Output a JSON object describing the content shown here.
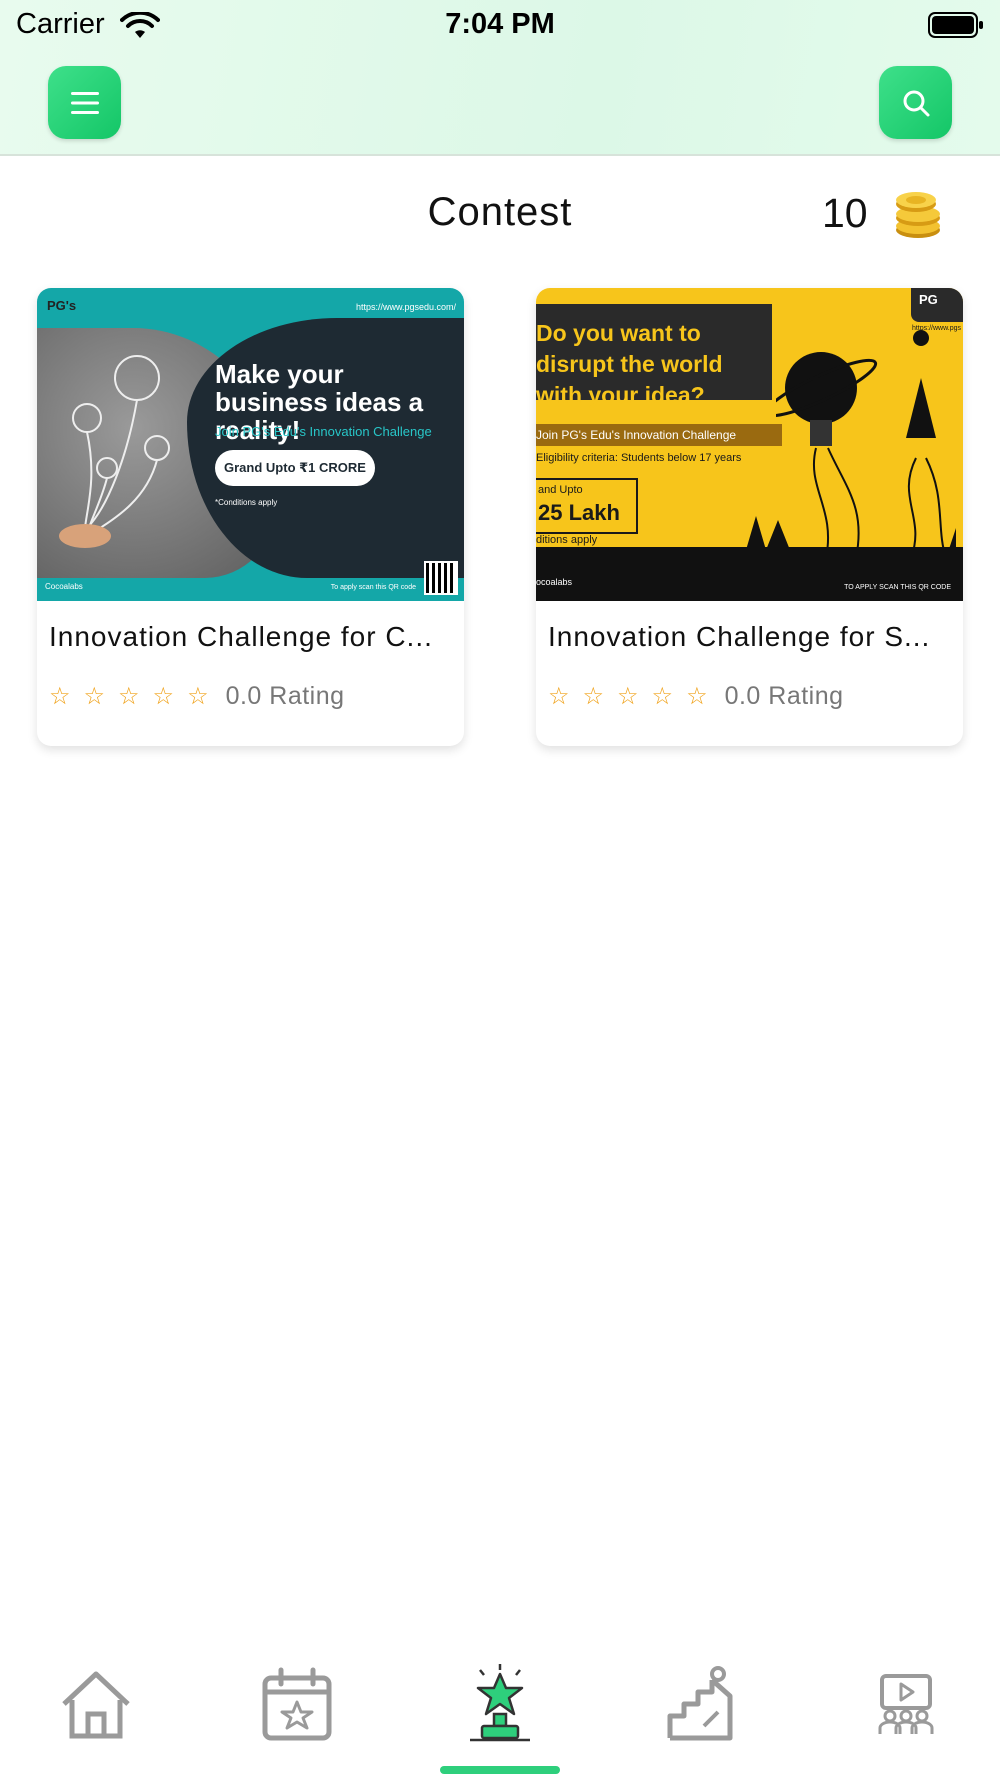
{
  "status_bar": {
    "carrier": "Carrier",
    "time": "7:04 PM"
  },
  "header": {
    "menu_icon": "hamburger-icon",
    "search_icon": "search-icon"
  },
  "page": {
    "title": "Contest",
    "coins": "10",
    "coin_icon": "coins-icon"
  },
  "contests": [
    {
      "title": "Innovation Challenge for C...",
      "rating_text": "0.0 Rating",
      "stars": 0,
      "banner": {
        "logo": "PG's",
        "url": "https://www.pgsedu.com/",
        "headline": "Make your business ideas a reality!",
        "subline": "Join PG's Edu's Innovation Challenge",
        "prize": "Grand Upto ₹1 CRORE",
        "conditions": "*Conditions apply",
        "footer_left": "Cocoalabs",
        "footer_right": "To apply scan this QR code"
      }
    },
    {
      "title": "Innovation Challenge for S...",
      "rating_text": "0.0 Rating",
      "stars": 0,
      "banner": {
        "logo": "PG",
        "url": "https://www.pgs",
        "headline": "Do you want to disrupt the world with your idea?",
        "subline": "Join PG's Edu's Innovation Challenge",
        "eligibility": "Eligibility criteria: Students below 17 years",
        "prize_small": "and Upto",
        "prize_big": "25 Lakh",
        "conditions": "ditions apply",
        "footer_left": "ocoalabs",
        "footer_right": "TO APPLY SCAN THIS QR CODE"
      }
    }
  ],
  "tabbar": {
    "items": [
      "home-icon",
      "calendar-star-icon",
      "trophy-icon",
      "ladder-icon",
      "video-classroom-icon"
    ],
    "active_index": 2,
    "active_color": "#2ecf7c",
    "inactive_color": "#9a9a9a"
  },
  "colors": {
    "accent": "#1fd27a",
    "header_bg": "#e3faeb",
    "star": "#f0a21a"
  }
}
